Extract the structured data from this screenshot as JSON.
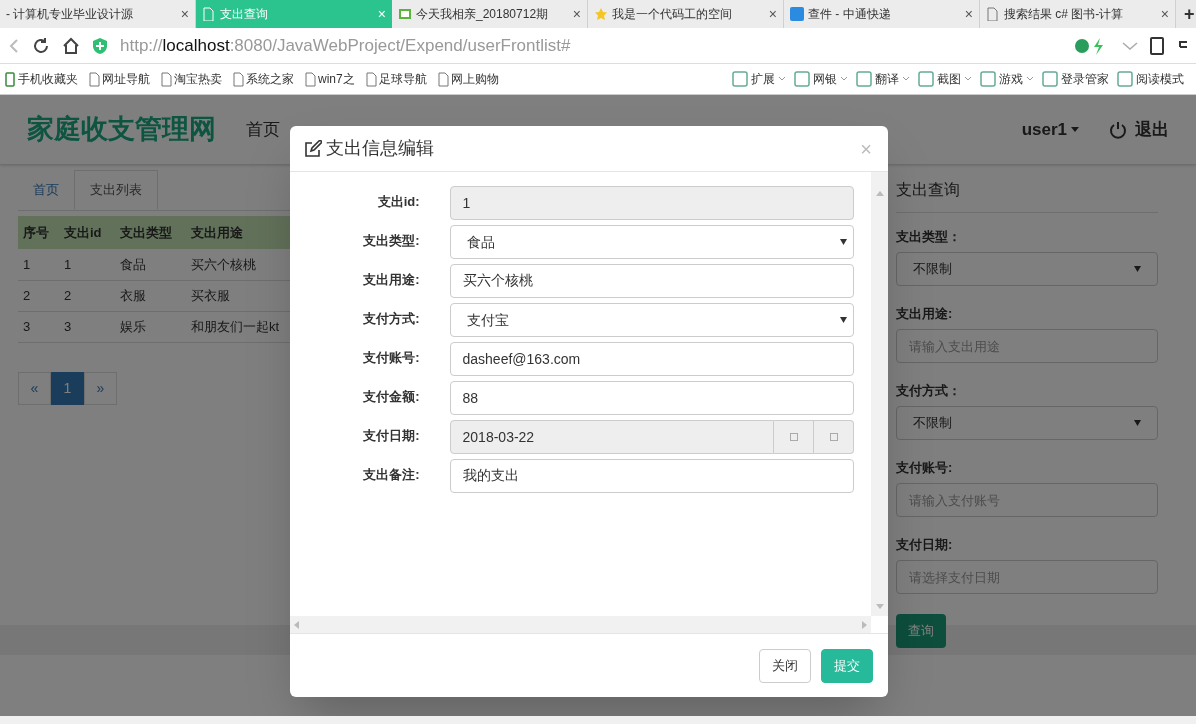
{
  "browser": {
    "tabs": [
      {
        "label": "- 计算机专业毕业设计源",
        "selected": false,
        "close": "×"
      },
      {
        "label": "支出查询",
        "selected": true,
        "close": "×"
      },
      {
        "label": "今天我相亲_20180712期",
        "selected": false,
        "close": "×"
      },
      {
        "label": "我是一个代码工的空间",
        "selected": false,
        "close": "×"
      },
      {
        "label": "查件 - 中通快递",
        "selected": false,
        "close": "×"
      },
      {
        "label": "搜索结果 c# 图书-计算",
        "selected": false,
        "close": "×"
      }
    ],
    "new_tab": "+",
    "address": {
      "scheme": "http://",
      "host": "localhost",
      "path": ":8080/JavaWebProject/Expend/userFrontlist#"
    },
    "bookmarks": [
      {
        "label": "手机收藏夹",
        "kind": "phone"
      },
      {
        "label": "网址导航",
        "kind": "page"
      },
      {
        "label": "淘宝热卖",
        "kind": "page"
      },
      {
        "label": "系统之家",
        "kind": "page"
      },
      {
        "label": "win7之",
        "kind": "page"
      },
      {
        "label": "足球导航",
        "kind": "page"
      },
      {
        "label": "网上购物",
        "kind": "page"
      }
    ],
    "toolbar": [
      {
        "label": "扩展",
        "dropdown": true
      },
      {
        "label": "网银",
        "dropdown": true
      },
      {
        "label": "翻译",
        "dropdown": true
      },
      {
        "label": "截图",
        "dropdown": true
      },
      {
        "label": "游戏",
        "dropdown": true
      },
      {
        "label": "登录管家",
        "dropdown": false
      },
      {
        "label": "阅读模式",
        "dropdown": false
      }
    ]
  },
  "page": {
    "brand": "家庭收支管理网",
    "nav": [
      "首页"
    ],
    "user": "user1",
    "logout": "退出",
    "tabs": [
      {
        "label": "首页",
        "selected": false
      },
      {
        "label": "支出列表",
        "selected": true
      }
    ],
    "table": {
      "columns": [
        "序号",
        "支出id",
        "支出类型",
        "支出用途"
      ],
      "rows": [
        [
          "1",
          "1",
          "食品",
          "买六个核桃"
        ],
        [
          "2",
          "2",
          "衣服",
          "买衣服"
        ],
        [
          "3",
          "3",
          "娱乐",
          "和朋友们一起kt"
        ]
      ]
    },
    "pagination": [
      {
        "label": "«",
        "selected": false
      },
      {
        "label": "1",
        "selected": true
      },
      {
        "label": "»",
        "selected": false
      }
    ],
    "search": {
      "title": "支出查询",
      "fields": [
        {
          "label": "支出类型：",
          "kind": "select",
          "value": "不限制"
        },
        {
          "label": "支出用途:",
          "kind": "input",
          "placeholder": "请输入支出用途"
        },
        {
          "label": "支付方式：",
          "kind": "select",
          "value": "不限制"
        },
        {
          "label": "支付账号:",
          "kind": "input",
          "placeholder": "请输入支付账号"
        },
        {
          "label": "支付日期:",
          "kind": "input",
          "placeholder": "请选择支付日期"
        }
      ],
      "button": "查询"
    }
  },
  "modal": {
    "title": "支出信息编辑",
    "close": "×",
    "fields": [
      {
        "label": "支出id:",
        "kind": "input",
        "value": "1",
        "disabled": true
      },
      {
        "label": "支出类型:",
        "kind": "select",
        "value": "食品",
        "disabled": false
      },
      {
        "label": "支出用途:",
        "kind": "input",
        "value": "买六个核桃",
        "disabled": false
      },
      {
        "label": "支付方式:",
        "kind": "select",
        "value": "支付宝",
        "disabled": false
      },
      {
        "label": "支付账号:",
        "kind": "input",
        "value": "dasheef@163.com",
        "disabled": false
      },
      {
        "label": "支付金额:",
        "kind": "input",
        "value": "88",
        "disabled": false
      },
      {
        "label": "支付日期:",
        "kind": "date",
        "value": "2018-03-22",
        "disabled": true
      },
      {
        "label": "支出备注:",
        "kind": "input",
        "value": "我的支出",
        "disabled": false
      }
    ],
    "buttons": [
      {
        "label": "关闭",
        "kind": "default"
      },
      {
        "label": "提交",
        "kind": "primary"
      }
    ]
  }
}
